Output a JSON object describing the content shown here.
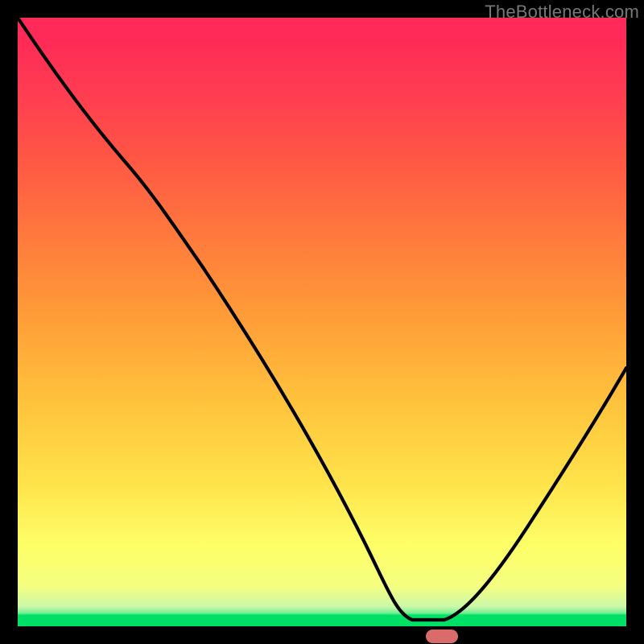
{
  "watermark": "TheBottleneck.com",
  "chart_data": {
    "type": "line",
    "title": "",
    "xlabel": "",
    "ylabel": "",
    "xlim": [
      0,
      100
    ],
    "ylim": [
      0,
      100
    ],
    "grid": false,
    "legend": false,
    "series": [
      {
        "name": "curve",
        "x": [
          0,
          15,
          30,
          45,
          58,
          63,
          67,
          71,
          75,
          85,
          100
        ],
        "values": [
          100,
          80,
          65,
          42,
          18,
          5,
          2,
          2,
          5,
          20,
          44
        ]
      }
    ],
    "marker": {
      "x": 67,
      "y": 2,
      "color": "#d96b6b"
    }
  },
  "colors": {
    "frame": "#000000",
    "marker": "#d96b6b",
    "curve": "#000000",
    "gradient_top": "#ff2a57",
    "gradient_bottom": "#00e066"
  }
}
